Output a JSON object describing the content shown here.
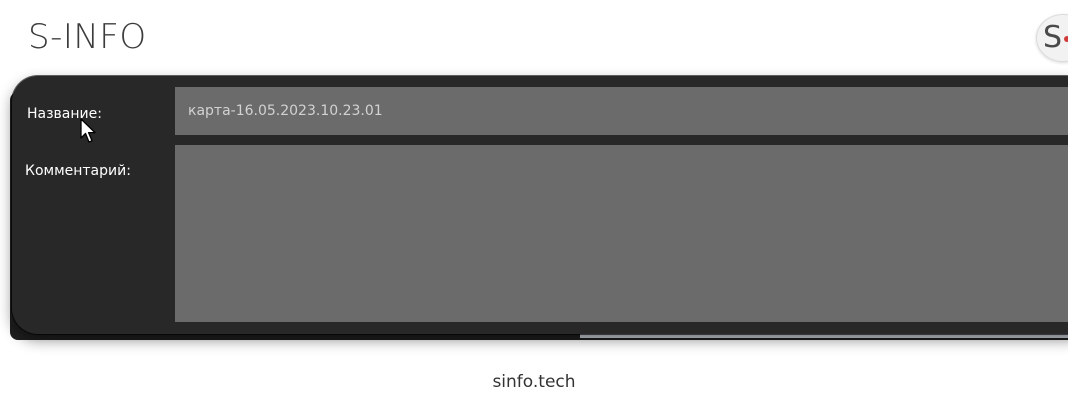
{
  "header": {
    "title": "S-INFO",
    "logo_letter": "S"
  },
  "dialog": {
    "name_label": "Название:",
    "name_value": "карта-16.05.2023.10.23.01",
    "comment_label": "Комментарий:",
    "comment_value": ""
  },
  "footer": {
    "link_text": "sinfo.tech"
  },
  "icons": {
    "cursor": "mouse-pointer-icon"
  },
  "colors": {
    "dialog_bg": "#282828",
    "input_bg": "#6b6b6b",
    "input_text": "#d2d2d2",
    "logo_accent": "#d23a3a"
  }
}
